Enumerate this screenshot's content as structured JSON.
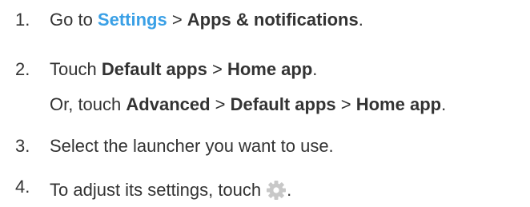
{
  "steps": [
    {
      "number": "1.",
      "parts": {
        "prefix": "Go to ",
        "settings_link": "Settings",
        "sep": " > ",
        "apps": "Apps & notifications",
        "end": "."
      }
    },
    {
      "number": "2.",
      "parts": {
        "prefix": "Touch ",
        "default_apps": "Default apps",
        "sep": " > ",
        "home_app": "Home app",
        "end": "."
      },
      "alt": {
        "prefix": "Or, touch ",
        "advanced": "Advanced",
        "sep1": " > ",
        "default_apps": "Default apps",
        "sep2": " > ",
        "home_app": "Home app",
        "end": "."
      }
    },
    {
      "number": "3.",
      "text": "Select the launcher you want to use."
    },
    {
      "number": "4.",
      "parts": {
        "prefix": "To adjust its settings, touch",
        "end": "."
      },
      "icon": "gear-icon"
    }
  ],
  "colors": {
    "link": "#3aa0e6",
    "text": "#333333",
    "icon": "#c8c8c8"
  }
}
